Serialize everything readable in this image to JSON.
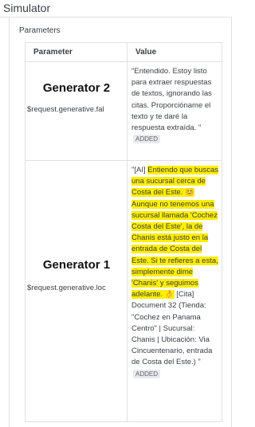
{
  "header": {
    "title": "Simulator"
  },
  "parameters": {
    "section_label": "Parameters",
    "columns": {
      "parameter": "Parameter",
      "value": "Value"
    },
    "rows": [
      {
        "name": "Generator 2",
        "variable": "$request.generative.fal",
        "value_text": "\"Entendido. Estoy listo para extraer respuestas de textos, ignorando las citas. Proporcióname el texto y te daré la respuesta extraída. \"",
        "badge": "ADDED"
      },
      {
        "name": "Generator 1",
        "variable": "$request.generative.loc",
        "value_prefix": "\"[AI] ",
        "value_highlight": "Entiendo que buscas una sucursal cerca de Costa del Este. 😊 Aunque no tenemos una sucursal llamada 'Cochez Costa del Este', la de Chanis está justo en la entrada de Costa del Este. Si te refieres a esta, simplemente dime 'Chanis' y seguimos adelante. 👌",
        "value_suffix": " [Cita] Document 32 (Tienda: \"Cochez en Panama Centro\" | Sucursal: Chanis | Ubicación: Via Cincuentenario, entrada de Costa del Este.) \"",
        "badge": "ADDED"
      }
    ]
  },
  "colors": {
    "highlight": "#ffee00",
    "border": "#e0e0e0",
    "badge_bg": "#e8eaed"
  }
}
